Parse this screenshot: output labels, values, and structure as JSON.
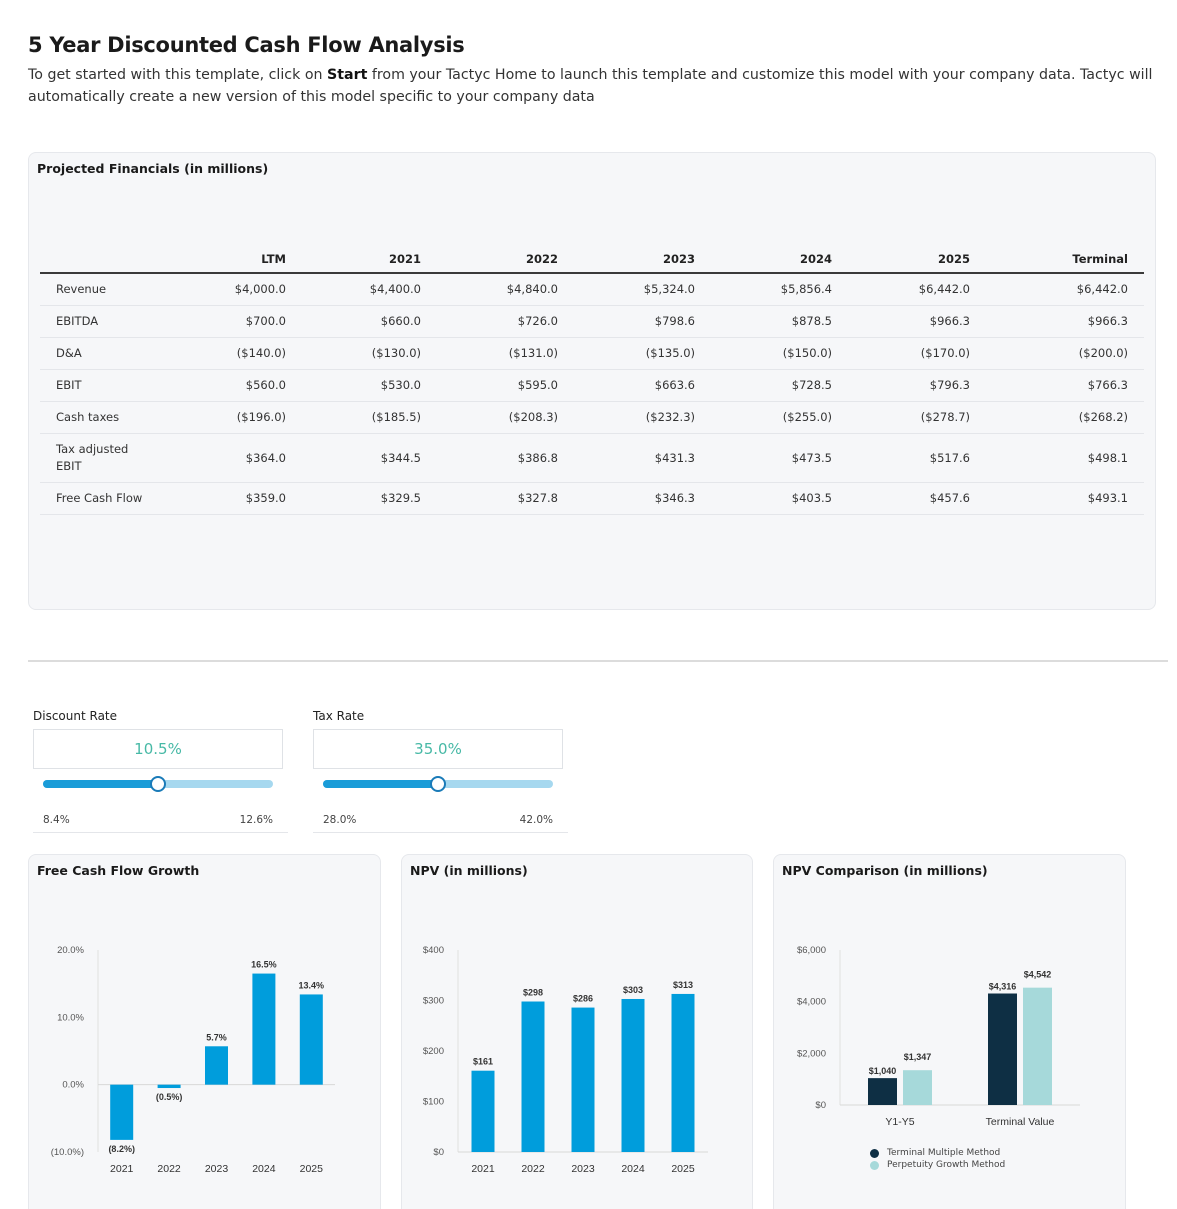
{
  "page": {
    "title": "5 Year Discounted Cash Flow Analysis",
    "desc_prefix": "To get started with this template, click on ",
    "desc_bold": "Start",
    "desc_suffix": " from your Tactyc Home to launch this template and customize this model with your company data. Tactyc will automatically create a new version of this model specific to your company data"
  },
  "financials": {
    "title": "Projected Financials (in millions)",
    "columns": [
      "LTM",
      "2021",
      "2022",
      "2023",
      "2024",
      "2025",
      "Terminal"
    ],
    "rows": [
      {
        "label": "Revenue",
        "values": [
          "$4,000.0",
          "$4,400.0",
          "$4,840.0",
          "$5,324.0",
          "$5,856.4",
          "$6,442.0",
          "$6,442.0"
        ]
      },
      {
        "label": "EBITDA",
        "values": [
          "$700.0",
          "$660.0",
          "$726.0",
          "$798.6",
          "$878.5",
          "$966.3",
          "$966.3"
        ]
      },
      {
        "label": "D&A",
        "values": [
          "($140.0)",
          "($130.0)",
          "($131.0)",
          "($135.0)",
          "($150.0)",
          "($170.0)",
          "($200.0)"
        ]
      },
      {
        "label": "EBIT",
        "values": [
          "$560.0",
          "$530.0",
          "$595.0",
          "$663.6",
          "$728.5",
          "$796.3",
          "$766.3"
        ]
      },
      {
        "label": "Cash taxes",
        "values": [
          "($196.0)",
          "($185.5)",
          "($208.3)",
          "($232.3)",
          "($255.0)",
          "($278.7)",
          "($268.2)"
        ]
      },
      {
        "label": "Tax adjusted EBIT",
        "label_line1": "Tax adjusted",
        "label_line2": "EBIT",
        "values": [
          "$364.0",
          "$344.5",
          "$386.8",
          "$431.3",
          "$473.5",
          "$517.6",
          "$498.1"
        ]
      },
      {
        "label": "Free Cash Flow",
        "values": [
          "$359.0",
          "$329.5",
          "$327.8",
          "$346.3",
          "$403.5",
          "$457.6",
          "$493.1"
        ]
      }
    ]
  },
  "sliders": {
    "discount": {
      "label": "Discount Rate",
      "value": "10.5%",
      "min": "8.4%",
      "max": "12.6%",
      "fraction": 0.5
    },
    "tax": {
      "label": "Tax Rate",
      "value": "35.0%",
      "min": "28.0%",
      "max": "42.0%",
      "fraction": 0.5
    }
  },
  "colors": {
    "primary_bar": "#009ddc",
    "dark_bar": "#0e2f44",
    "light_bar": "#a6d9da",
    "accent_text": "#47b9a6"
  },
  "chart_data": [
    {
      "type": "bar",
      "title": "Free Cash Flow Growth",
      "categories": [
        "2021",
        "2022",
        "2023",
        "2024",
        "2025"
      ],
      "values": [
        -8.2,
        -0.5,
        5.7,
        16.5,
        13.4
      ],
      "labels": [
        "(8.2%)",
        "(0.5%)",
        "5.7%",
        "16.5%",
        "13.4%"
      ],
      "yticks": [
        "(10.0%)",
        "0.0%",
        "10.0%",
        "20.0%"
      ],
      "ylim": [
        -10,
        20
      ],
      "grid": false
    },
    {
      "type": "bar",
      "title": "NPV (in millions)",
      "categories": [
        "2021",
        "2022",
        "2023",
        "2024",
        "2025"
      ],
      "values": [
        161,
        298,
        286,
        303,
        313
      ],
      "labels": [
        "$161",
        "$298",
        "$286",
        "$303",
        "$313"
      ],
      "yticks": [
        "$0",
        "$100",
        "$200",
        "$300",
        "$400"
      ],
      "ylim": [
        0,
        400
      ],
      "grid": false
    },
    {
      "type": "bar",
      "title": "NPV Comparison (in millions)",
      "categories": [
        "Y1-Y5",
        "Terminal Value"
      ],
      "series": [
        {
          "name": "Terminal Multiple Method",
          "values": [
            1040,
            4316
          ],
          "labels": [
            "$1,040",
            "$4,316"
          ]
        },
        {
          "name": "Perpetuity Growth Method",
          "values": [
            1347,
            4542
          ],
          "labels": [
            "$1,347",
            "$4,542"
          ]
        }
      ],
      "yticks": [
        "$0",
        "$2,000",
        "$4,000",
        "$6,000"
      ],
      "ylim": [
        0,
        6000
      ],
      "legend": "bottom-left",
      "grid": false
    }
  ]
}
